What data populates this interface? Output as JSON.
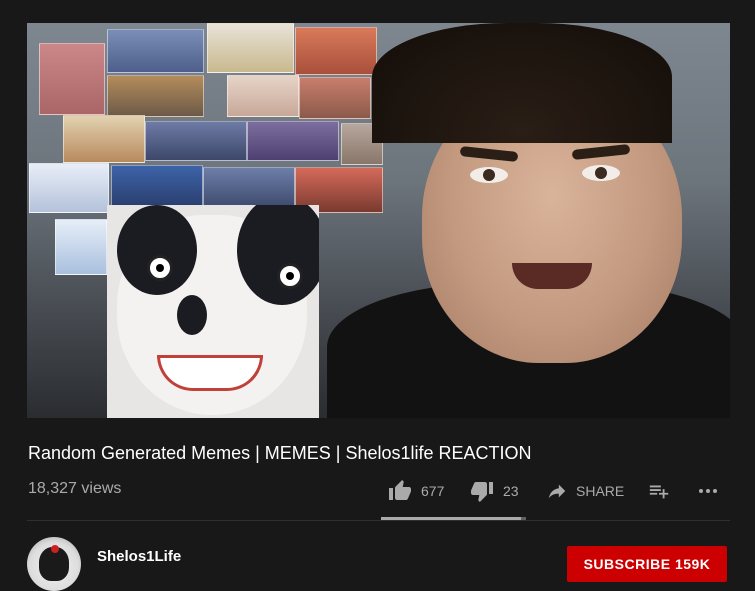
{
  "video": {
    "title": "Random Generated Memes | MEMES | Shelos1life REACTION",
    "views": "18,327 views"
  },
  "actions": {
    "like_count": "677",
    "dislike_count": "23",
    "share_label": "SHARE",
    "like_ratio": 0.967
  },
  "channel": {
    "name": "Shelos1Life",
    "subscribe_label": "SUBSCRIBE",
    "subscriber_count": "159K"
  },
  "icons": {
    "like": "thumbs-up-icon",
    "dislike": "thumbs-down-icon",
    "share": "share-arrow-icon",
    "save": "add-to-playlist-icon",
    "more": "more-horizontal-icon"
  },
  "colors": {
    "background": "#181818",
    "subscribe": "#cc0000",
    "secondary_text": "#aaaaaa"
  }
}
